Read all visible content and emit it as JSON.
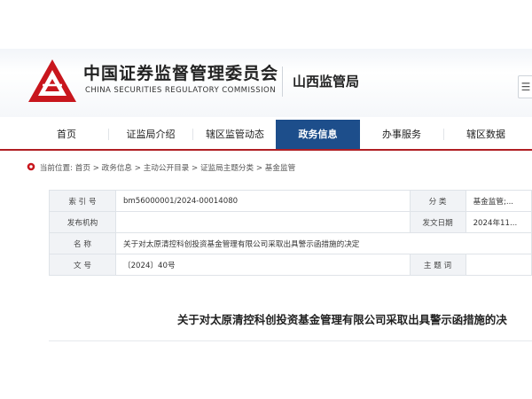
{
  "header": {
    "org_name_cn": "中国证券监督管理委员会",
    "org_name_en": "CHINA SECURITIES REGULATORY COMMISSION",
    "bureau": "山西监管局"
  },
  "nav": {
    "items": [
      {
        "label": "首页"
      },
      {
        "label": "证监局介绍"
      },
      {
        "label": "辖区监管动态"
      },
      {
        "label": "政务信息",
        "active": true
      },
      {
        "label": "办事服务"
      },
      {
        "label": "辖区数据"
      }
    ]
  },
  "breadcrumb": {
    "prefix": "当前位置:",
    "items": [
      "首页",
      "政务信息",
      "主动公开目录",
      "证监局主题分类",
      "基金监管"
    ],
    "separator": ">"
  },
  "info": {
    "index_label": "索 引 号",
    "index_value": "bm56000001/2024-00014080",
    "category_label": "分    类",
    "category_value": "基金监管;...",
    "issuer_label": "发布机构",
    "issuer_value": "",
    "date_label": "发文日期",
    "date_value": "2024年11...",
    "name_label": "名    称",
    "name_value": "关于对太原清控科创投资基金管理有限公司采取出具警示函措施的决定",
    "docno_label": "文    号",
    "docno_value": "〔2024〕40号",
    "topic_label": "主 题 词",
    "topic_value": ""
  },
  "document": {
    "title": "关于对太原清控科创投资基金管理有限公司采取出具警示函措施的决"
  },
  "colors": {
    "nav_active": "#1d4e8b",
    "nav_border": "#b01e23",
    "logo_red": "#c8161d"
  }
}
